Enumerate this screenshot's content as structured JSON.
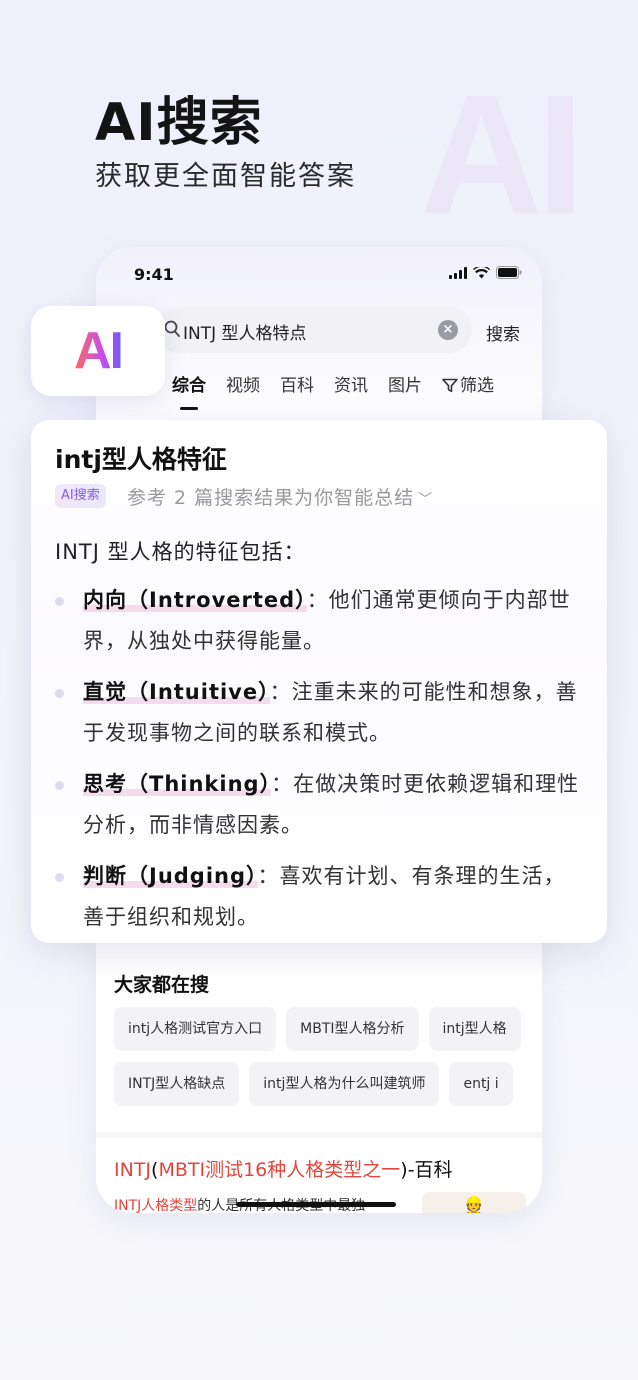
{
  "hero": {
    "title": "AI搜索",
    "subtitle": "获取更全面智能答案",
    "bg_letters": "AI"
  },
  "status_bar": {
    "time": "9:41"
  },
  "search": {
    "query": "INTJ 型人格特点",
    "button_label": "搜索"
  },
  "tabs": [
    {
      "label": "综合",
      "active": true
    },
    {
      "label": "视频"
    },
    {
      "label": "百科"
    },
    {
      "label": "资讯"
    },
    {
      "label": "图片"
    },
    {
      "label": "筛选",
      "icon": "filter-icon"
    }
  ],
  "ai_badge": {
    "text": "AI"
  },
  "ai_card": {
    "title": "intj型人格特征",
    "tag": "AI搜索",
    "reference": "参考 2 篇搜索结果为你智能总结",
    "intro": "INTJ 型人格的特征包括：",
    "bullets": [
      {
        "term": "内向（Introverted）",
        "text": "：他们通常更倾向于内部世界，从独处中获得能量。"
      },
      {
        "term": "直觉（Intuitive）",
        "text": "：注重未来的可能性和想象，善于发现事物之间的联系和模式。"
      },
      {
        "term": "思考（Thinking）",
        "text": "：在做决策时更依赖逻辑和理性分析，而非情感因素。"
      },
      {
        "term": "判断（Judging）",
        "text": "：喜欢有计划、有条理的生活，善于组织和规划。"
      }
    ]
  },
  "hot_searches": {
    "title": "大家都在搜",
    "row1": [
      "intj人格测试官方入口",
      "MBTI型人格分析",
      "intj型人格"
    ],
    "row2": [
      "INTJ型人格缺点",
      "intj型人格为什么叫建筑师",
      "entj i"
    ]
  },
  "result": {
    "title_parts": [
      "INTJ",
      "(",
      "MBTI测试16种人格类型之一",
      ")-百科"
    ],
    "snippet_hl": "INTJ人格类型",
    "snippet_rest": "的人是所有人格类型中最独"
  },
  "colors": {
    "accent_red": "#e0473e",
    "ai_purple": "#8a5cd8"
  }
}
